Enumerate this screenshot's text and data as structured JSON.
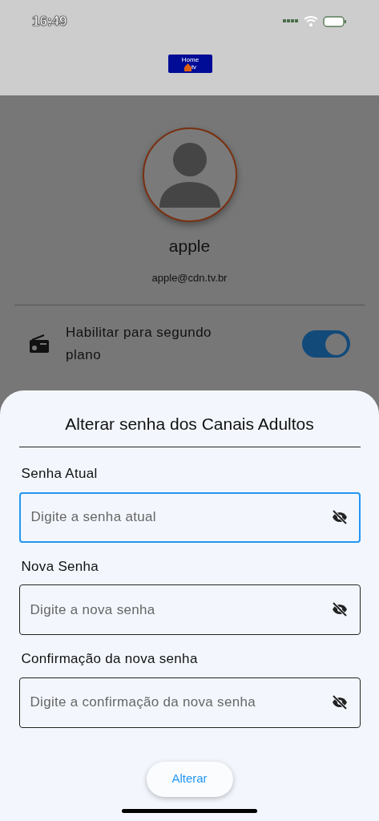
{
  "status_bar": {
    "time": "16:49"
  },
  "header": {
    "logo": {
      "top_text": "Home",
      "bottom_text": "tv"
    }
  },
  "profile": {
    "name": "apple",
    "email": "apple@cdn.tv.br"
  },
  "settings": [
    {
      "label": "Habilitar para segundo plano",
      "on": true
    }
  ],
  "sheet": {
    "title": "Alterar senha dos Canais Adultos",
    "fields": [
      {
        "label": "Senha Atual",
        "placeholder": "Digite a senha atual",
        "focused": true
      },
      {
        "label": "Nova Senha",
        "placeholder": "Digite a nova senha",
        "focused": false
      },
      {
        "label": "Confirmação da nova senha",
        "placeholder": "Digite a confirmação da nova senha",
        "focused": false
      }
    ],
    "button": "Alterar"
  }
}
